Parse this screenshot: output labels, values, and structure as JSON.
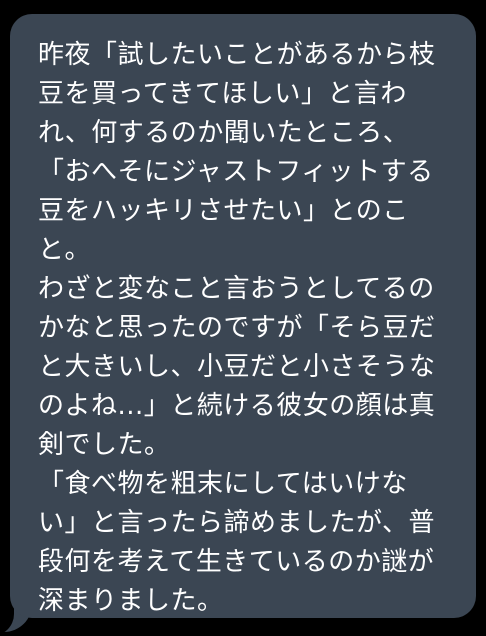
{
  "message": {
    "lines": [
      "昨夜「試したいことがあるから枝",
      "豆を買ってきてほしい」と言わ",
      "れ、何するのか聞いたところ、",
      "「おへそにジャストフィットする",
      "豆をハッキリさせたい」とのこ",
      "と。",
      "わざと変なこと言おうとしてるの",
      "かなと思ったのですが「そら豆だ",
      "と大きいし、小豆だと小さそうな",
      "のよね...」と続ける彼女の顔は真",
      "剣でした。",
      "「食べ物を粗末にしてはいけな",
      "い」と言ったら諦めましたが、普",
      "段何を考えて生きているのか謎が",
      "深まりました。"
    ]
  },
  "colors": {
    "background": "#000000",
    "bubble": "#3b4653",
    "text": "#ffffff"
  }
}
